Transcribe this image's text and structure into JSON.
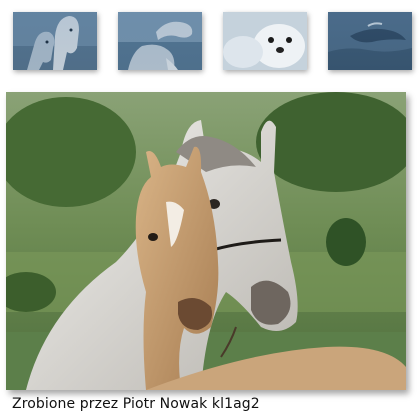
{
  "gallery": {
    "thumbnails": [
      {
        "icon": "horses-thumbnail-icon"
      },
      {
        "icon": "dolphin-thumbnail-icon"
      },
      {
        "icon": "seal-pup-thumbnail-icon"
      },
      {
        "icon": "whale-thumbnail-icon"
      }
    ],
    "main_image": {
      "icon": "horses-photo"
    },
    "caption": "Zrobione przez Piotr Nowak kl1ag2"
  },
  "colors": {
    "background": "#ffffff",
    "thumb_tint": "#5f7f9c",
    "caption_text": "#111111"
  }
}
